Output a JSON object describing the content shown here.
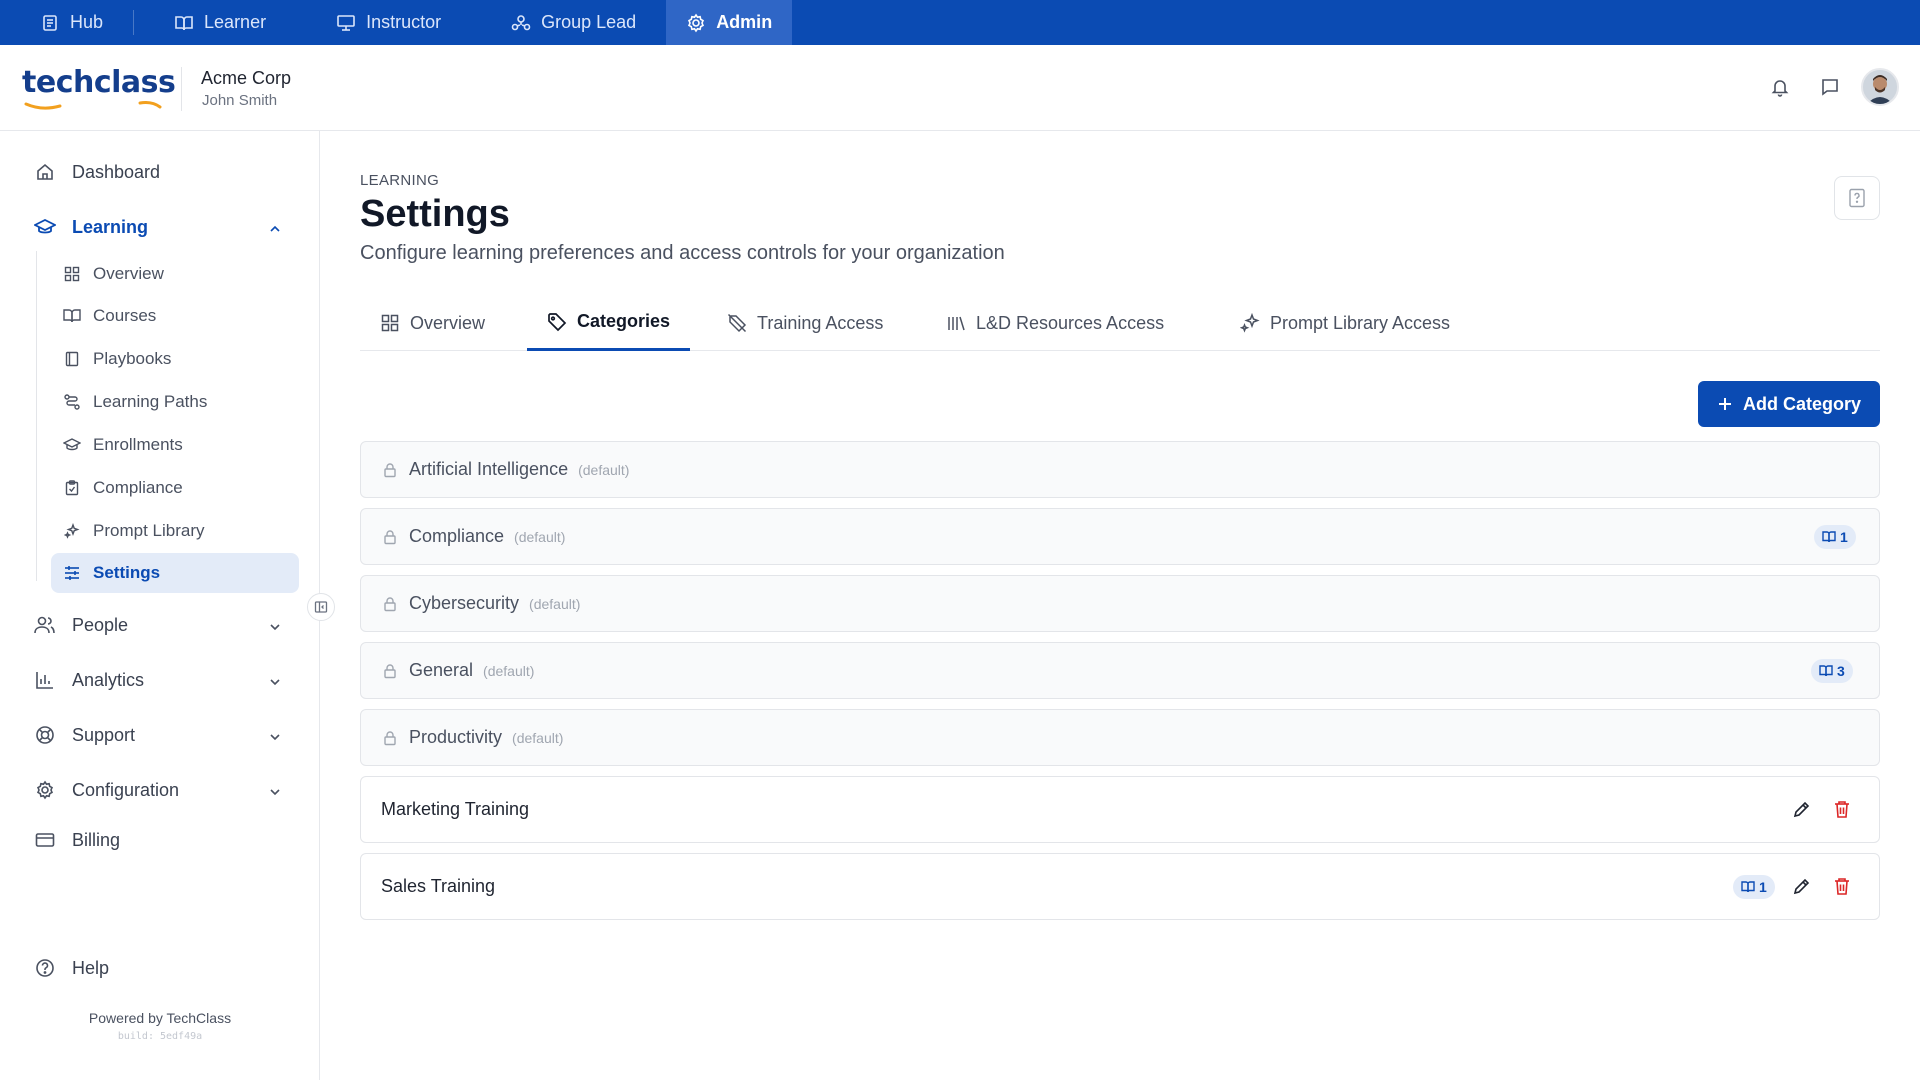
{
  "topnav": {
    "items": [
      {
        "label": "Hub",
        "icon": "document-icon"
      },
      {
        "label": "Learner",
        "icon": "book-open-icon"
      },
      {
        "label": "Instructor",
        "icon": "presentation-icon"
      },
      {
        "label": "Group Lead",
        "icon": "group-icon"
      },
      {
        "label": "Admin",
        "icon": "gear-icon",
        "active": true
      }
    ]
  },
  "header": {
    "logo_text": "techclass",
    "org_name": "Acme Corp",
    "user_name": "John Smith"
  },
  "sidebar": {
    "dashboard": "Dashboard",
    "learning": "Learning",
    "learning_items": [
      "Overview",
      "Courses",
      "Playbooks",
      "Learning Paths",
      "Enrollments",
      "Compliance",
      "Prompt Library",
      "Settings"
    ],
    "people": "People",
    "analytics": "Analytics",
    "support": "Support",
    "configuration": "Configuration",
    "billing": "Billing",
    "help": "Help",
    "powered_by": "Powered by TechClass",
    "build": "build: 5edf49a"
  },
  "main": {
    "breadcrumb": "LEARNING",
    "title": "Settings",
    "subtitle": "Configure learning preferences and access controls for your organization",
    "tabs": [
      "Overview",
      "Categories",
      "Training Access",
      "L&D Resources Access",
      "Prompt Library Access"
    ],
    "active_tab": "Categories",
    "add_button": "Add Category",
    "default_label": "(default)",
    "categories": [
      {
        "name": "Artificial Intelligence",
        "default": true,
        "count": null
      },
      {
        "name": "Compliance",
        "default": true,
        "count": "1"
      },
      {
        "name": "Cybersecurity",
        "default": true,
        "count": null
      },
      {
        "name": "General",
        "default": true,
        "count": "3"
      },
      {
        "name": "Productivity",
        "default": true,
        "count": null
      },
      {
        "name": "Marketing Training",
        "default": false,
        "count": null
      },
      {
        "name": "Sales Training",
        "default": false,
        "count": "1"
      }
    ]
  },
  "colors": {
    "brand": "#0b4bb3",
    "accent_orange": "#f2a01e",
    "delete_red": "#dc2626"
  }
}
